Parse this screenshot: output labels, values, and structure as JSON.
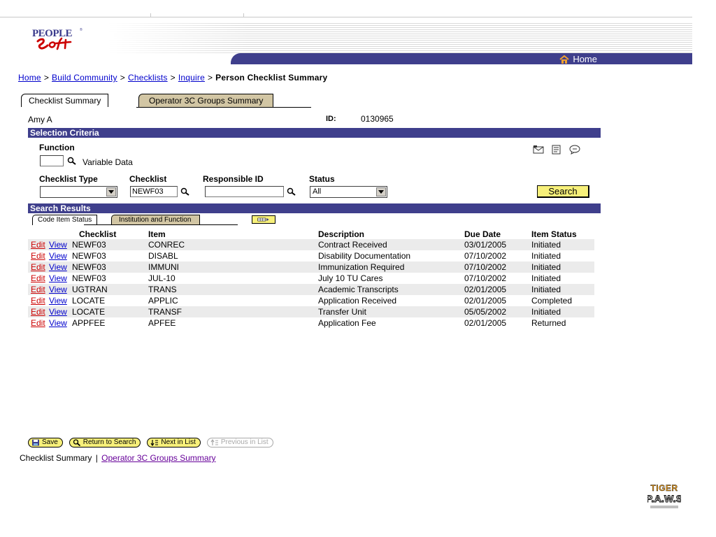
{
  "header": {
    "brand_logo": "PeopleSoft",
    "home_label": "Home"
  },
  "breadcrumb": {
    "items": [
      "Home",
      "Build Community",
      "Checklists",
      "Inquire"
    ],
    "separator": ">",
    "current": "Person Checklist Summary"
  },
  "tabs": [
    {
      "label": "Checklist Summary",
      "active": true
    },
    {
      "label": "Operator 3C Groups Summary",
      "active": false
    }
  ],
  "person": {
    "name": "Amy A",
    "id_label": "ID:",
    "id_value": "0130965"
  },
  "selection": {
    "title": "Selection Criteria",
    "function_label": "Function",
    "function_value": "",
    "variable_data_label": "Variable Data",
    "checklist_type_label": "Checklist Type",
    "checklist_type_value": "",
    "checklist_label": "Checklist",
    "checklist_value": "NEWF03",
    "responsible_id_label": "Responsible ID",
    "responsible_id_value": "",
    "status_label": "Status",
    "status_value": "All",
    "search_label": "Search",
    "toolbar_icons": [
      "mail-icon",
      "notes-icon",
      "chat-icon"
    ]
  },
  "results": {
    "title": "Search Results",
    "tabs": [
      {
        "label": "Code Item Status",
        "active": true
      },
      {
        "label": "Institution and Function",
        "active": false
      }
    ],
    "show_all_columns_icon": "grid-expand-icon",
    "columns": [
      "Checklist",
      "Item",
      "Description",
      "Due Date",
      "Item Status"
    ],
    "edit_label": "Edit",
    "view_label": "View",
    "rows": [
      {
        "checklist": "NEWF03",
        "item": "CONREC",
        "description": "Contract Received",
        "due_date": "03/01/2005",
        "status": "Initiated"
      },
      {
        "checklist": "NEWF03",
        "item": "DISABL",
        "description": "Disability Documentation",
        "due_date": "07/10/2002",
        "status": "Initiated"
      },
      {
        "checklist": "NEWF03",
        "item": "IMMUNI",
        "description": "Immunization Required",
        "due_date": "07/10/2002",
        "status": "Initiated"
      },
      {
        "checklist": "NEWF03",
        "item": "JUL-10",
        "description": "July 10 TU Cares",
        "due_date": "07/10/2002",
        "status": "Initiated"
      },
      {
        "checklist": "UGTRAN",
        "item": "TRANS",
        "description": "Academic Transcripts",
        "due_date": "02/01/2005",
        "status": "Initiated"
      },
      {
        "checklist": "LOCATE",
        "item": "APPLIC",
        "description": "Application Received",
        "due_date": "02/01/2005",
        "status": "Completed"
      },
      {
        "checklist": "LOCATE",
        "item": "TRANSF",
        "description": "Transfer Unit",
        "due_date": "05/05/2002",
        "status": "Initiated"
      },
      {
        "checklist": "APPFEE",
        "item": "APFEE",
        "description": "Application Fee",
        "due_date": "02/01/2005",
        "status": "Returned"
      }
    ]
  },
  "buttons": {
    "save": "Save",
    "return_to_search": "Return to Search",
    "next_in_list": "Next in List",
    "previous_in_list": "Previous in List"
  },
  "footer": {
    "link1": "Checklist Summary",
    "separator": "|",
    "link2": "Operator 3C Groups Summary"
  },
  "corner_logo": {
    "line1": "TIGER",
    "line2": "P.A.W.S"
  },
  "colors": {
    "section_bar": "#3f3f8c",
    "tab_inactive": "#d2c6a4",
    "button_yellow": "#f7f07a",
    "edit_link": "#cc0000",
    "link": "#0000cc",
    "row_alt": "#ebebeb"
  }
}
